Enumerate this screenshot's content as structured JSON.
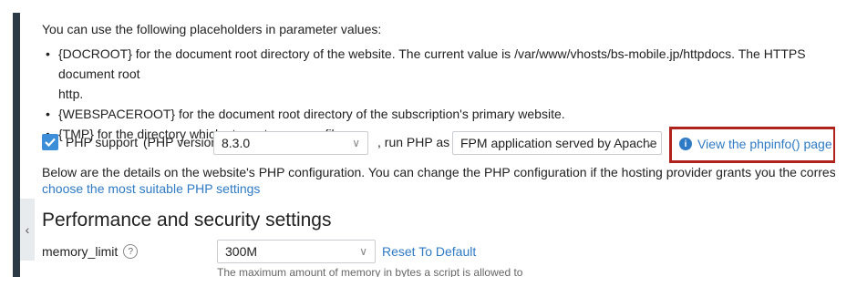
{
  "intro": "You can use the following placeholders in parameter values:",
  "placeholders": [
    {
      "line1": "{DOCROOT} for the document root directory of the website. The current value is /var/www/vhosts/bs-mobile.jp/httpdocs. The HTTPS document root",
      "line2": "http."
    },
    {
      "line1": "{WEBSPACEROOT} for the document root directory of the subscription's primary website."
    },
    {
      "line1": "{TMP} for the directory which stores temporary files."
    }
  ],
  "php_support": {
    "checked": true,
    "label": "PHP support",
    "version_prefix": "(PHP version",
    "version_value": "8.3.0",
    "run_label": ", run PHP as",
    "handler_value": "FPM application served by Apache"
  },
  "phpinfo_link": "View the phpinfo() page",
  "details_text": "Below are the details on the website's PHP configuration. You can change the PHP configuration if the hosting provider grants you the corresponding permissions. Or",
  "choose_link": "choose the most suitable PHP settings",
  "section_title": "Performance and security settings",
  "memory_limit": {
    "label": "memory_limit",
    "value": "300M",
    "reset": "Reset To Default",
    "description": "The maximum amount of memory in bytes a script is allowed to"
  },
  "colors": {
    "accent": "#2e7ac4",
    "highlight_border": "#b0221c",
    "sidebar": "#2b3a45"
  }
}
